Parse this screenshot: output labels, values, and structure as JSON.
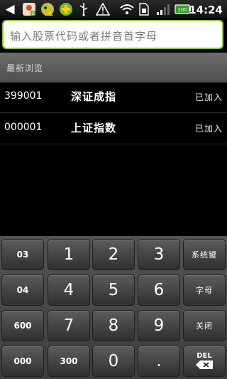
{
  "status_bar": {
    "time": "14:24",
    "icons": [
      "back-arrow-icon",
      "app-notification-icon",
      "app-warning-icon",
      "app-plus-icon",
      "usb-icon",
      "warning-icon",
      "wifi-icon",
      "sim-icon",
      "signal-icon",
      "battery-icon"
    ],
    "app_badge": "2",
    "battery_label": "100"
  },
  "search": {
    "placeholder": "输入股票代码或者拼音首字母"
  },
  "recent": {
    "title": "最新浏览"
  },
  "stocks": [
    {
      "code": "399001",
      "name": "深证成指",
      "status": "已加入"
    },
    {
      "code": "000001",
      "name": "上证指数",
      "status": "已加入"
    }
  ],
  "keyboard": {
    "rows": [
      [
        "03",
        "1",
        "2",
        "3",
        "系统键"
      ],
      [
        "04",
        "4",
        "5",
        "6",
        "字母"
      ],
      [
        "600",
        "7",
        "8",
        "9",
        "关闭"
      ],
      [
        "000",
        "300",
        "0",
        ".",
        "DEL"
      ]
    ]
  },
  "colors": {
    "accent": "#8fc93f",
    "background": "#000000",
    "header_gray": "#5e5e5e"
  }
}
